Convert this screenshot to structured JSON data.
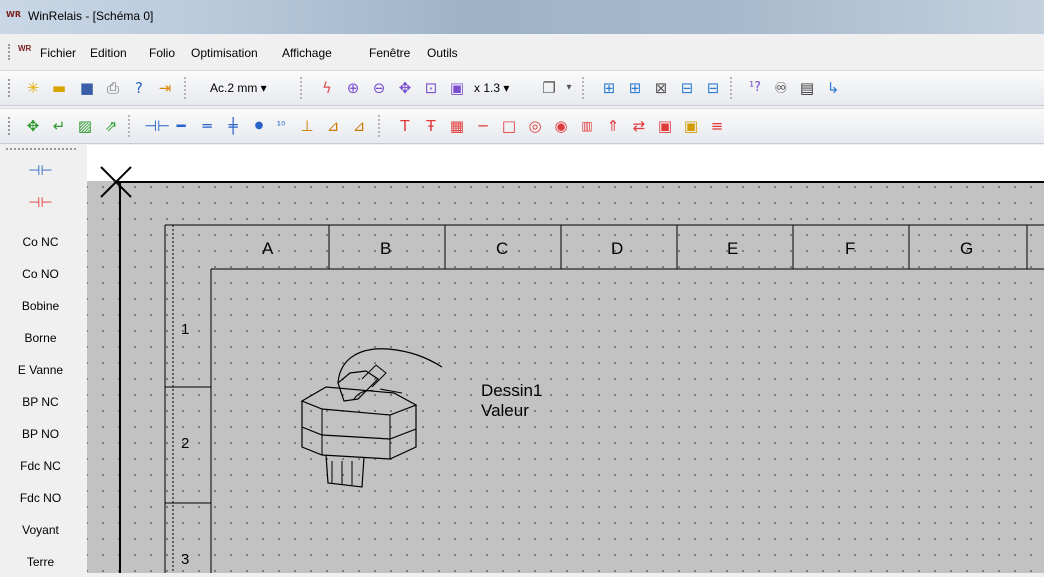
{
  "window": {
    "title": "WinRelais - [Schéma 0]",
    "app_icon": "winrelais-app-icon"
  },
  "menu": [
    "Fichier",
    "Edition",
    "Folio",
    "Optimisation",
    "Affichage",
    "Fenêtre",
    "Outils"
  ],
  "toolbar1": {
    "accuracy": "Ac.2 mm",
    "zoom": "x 1.3"
  },
  "palette": [
    "Co NC",
    "Co NO",
    "Bobine",
    "Borne",
    "E Vanne",
    "BP NC",
    "BP NO",
    "Fdc NC",
    "Fdc NO",
    "Voyant",
    "Terre"
  ],
  "grid": {
    "columns": [
      "A",
      "B",
      "C",
      "D",
      "E",
      "F",
      "G"
    ],
    "rows": [
      "1",
      "2",
      "3"
    ]
  },
  "drawing": {
    "name": "Dessin1",
    "value": "Valeur"
  },
  "colors": {
    "accent_blue": "#1f6fbf",
    "red_tool": "#e03a3a",
    "canvas_bg": "#c2c2c2"
  }
}
